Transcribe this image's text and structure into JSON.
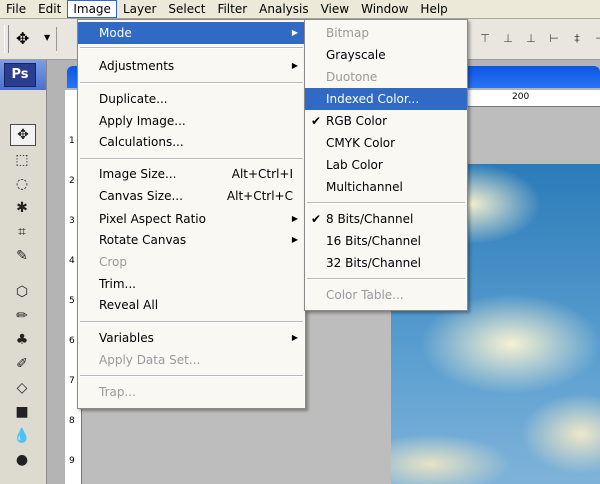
{
  "menubar": {
    "items": [
      {
        "label": "File"
      },
      {
        "label": "Edit"
      },
      {
        "label": "Image"
      },
      {
        "label": "Layer"
      },
      {
        "label": "Select"
      },
      {
        "label": "Filter"
      },
      {
        "label": "Analysis"
      },
      {
        "label": "View"
      },
      {
        "label": "Window"
      },
      {
        "label": "Help"
      }
    ]
  },
  "toolbox": {
    "logo": "Ps"
  },
  "rulers": {
    "top_tick": "200",
    "left_ticks": [
      "1",
      "2",
      "3",
      "4",
      "5",
      "6",
      "7",
      "8",
      "9"
    ]
  },
  "image_menu": {
    "mode": "Mode",
    "adjustments": "Adjustments",
    "duplicate": "Duplicate...",
    "apply_image": "Apply Image...",
    "calculations": "Calculations...",
    "image_size": "Image Size...",
    "image_size_sc": "Alt+Ctrl+I",
    "canvas_size": "Canvas Size...",
    "canvas_size_sc": "Alt+Ctrl+C",
    "pixel_aspect": "Pixel Aspect Ratio",
    "rotate_canvas": "Rotate Canvas",
    "crop": "Crop",
    "trim": "Trim...",
    "reveal_all": "Reveal All",
    "variables": "Variables",
    "apply_data_set": "Apply Data Set...",
    "trap": "Trap..."
  },
  "mode_menu": {
    "bitmap": "Bitmap",
    "grayscale": "Grayscale",
    "duotone": "Duotone",
    "indexed_color": "Indexed Color...",
    "rgb_color": "RGB Color",
    "cmyk_color": "CMYK Color",
    "lab_color": "Lab Color",
    "multichannel": "Multichannel",
    "bits8": "8 Bits/Channel",
    "bits16": "16 Bits/Channel",
    "bits32": "32 Bits/Channel",
    "color_table": "Color Table..."
  },
  "colors": {
    "highlight": "#316ac5",
    "disabled": "#9a9a9a"
  }
}
